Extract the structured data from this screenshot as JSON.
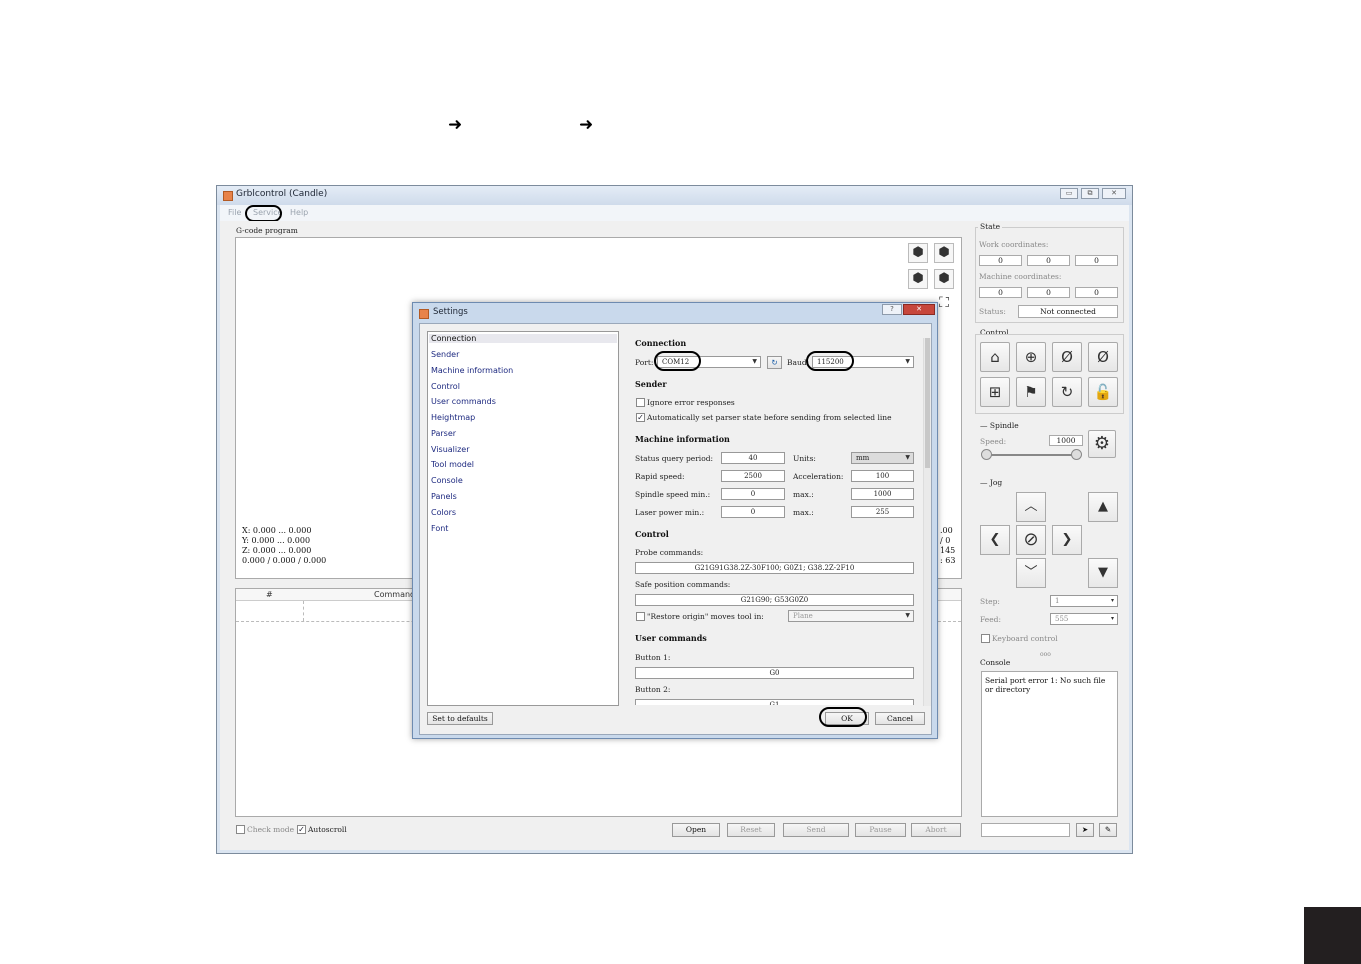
{
  "breadcrumb": {
    "arrow1": "➜",
    "arrow2": "➜"
  },
  "window": {
    "title": "Grblcontrol  (Candle)",
    "controls": [
      "▭",
      "⧉",
      "✕"
    ]
  },
  "menu": {
    "file": "File",
    "service": "Service",
    "help": "Help"
  },
  "gcode": {
    "group_label": "G-code program",
    "coords_left": [
      "X: 0.000 ... 0.000",
      "Y: 0.000 ... 0.000",
      "Z: 0.000 ... 0.000",
      "0.000 / 0.000 / 0.000"
    ],
    "coords_right": [
      ".00",
      "/ 0",
      "145",
      ": 63"
    ],
    "table_headers": {
      "num": "#",
      "command": "Command"
    }
  },
  "bottom": {
    "check_mode": "Check mode",
    "autoscroll": "Autoscroll",
    "open": "Open",
    "reset": "Reset",
    "send": "Send",
    "pause": "Pause",
    "abort": "Abort"
  },
  "state": {
    "group_label": "State",
    "work_label": "Work coordinates:",
    "work_values": [
      "0",
      "0",
      "0"
    ],
    "machine_label": "Machine coordinates:",
    "machine_values": [
      "0",
      "0",
      "0"
    ],
    "status_label": "Status:",
    "status_value": "Not connected"
  },
  "control": {
    "group_label": "Control"
  },
  "spindle": {
    "group_label": "Spindle",
    "speed_label": "Speed:",
    "speed_value": "1000"
  },
  "jog": {
    "group_label": "Jog",
    "step_label": "Step:",
    "step_value": "1",
    "feed_label": "Feed:",
    "feed_value": "555",
    "keyboard_label": "Keyboard control"
  },
  "console": {
    "group_label": "Console",
    "dots": "ooo",
    "output": "Serial port error 1: No such file or directory"
  },
  "settings": {
    "title": "Settings",
    "help_btn": "?",
    "close_btn": "✕",
    "nav": [
      "Connection",
      "Sender",
      "Machine information",
      "Control",
      "User commands",
      "Heightmap",
      "Parser",
      "Visualizer",
      "Tool model",
      "Console",
      "Panels",
      "Colors",
      "Font"
    ],
    "connection_title": "Connection",
    "port_label": "Port:",
    "port_value": "COM12",
    "baud_label": "Baud:",
    "baud_value": "115200",
    "sender_title": "Sender",
    "ignore_errors": "Ignore error responses",
    "auto_parser": "Automatically set parser state before sending from selected line",
    "machine_title": "Machine information",
    "status_query_label": "Status query period:",
    "status_query_value": "40",
    "units_label": "Units:",
    "units_value": "mm",
    "rapid_label": "Rapid speed:",
    "rapid_value": "2500",
    "accel_label": "Acceleration:",
    "accel_value": "100",
    "spindle_min_label": "Spindle speed min.:",
    "spindle_min_value": "0",
    "spindle_max_label": "max.:",
    "spindle_max_value": "1000",
    "laser_min_label": "Laser power min.:",
    "laser_min_value": "0",
    "laser_max_label": "max.:",
    "laser_max_value": "255",
    "control_title": "Control",
    "probe_label": "Probe commands:",
    "probe_value": "G21G91G38.2Z-30F100; G0Z1; G38.2Z-2F10",
    "safe_label": "Safe position commands:",
    "safe_value": "G21G90; G53G0Z0",
    "restore_label": "\"Restore origin\" moves tool in:",
    "restore_value": "Plane",
    "user_title": "User commands",
    "button1_label": "Button 1:",
    "button1_value": "G0",
    "button2_label": "Button 2:",
    "button2_value": "G1",
    "set_defaults": "Set to defaults",
    "ok": "OK",
    "cancel": "Cancel"
  }
}
